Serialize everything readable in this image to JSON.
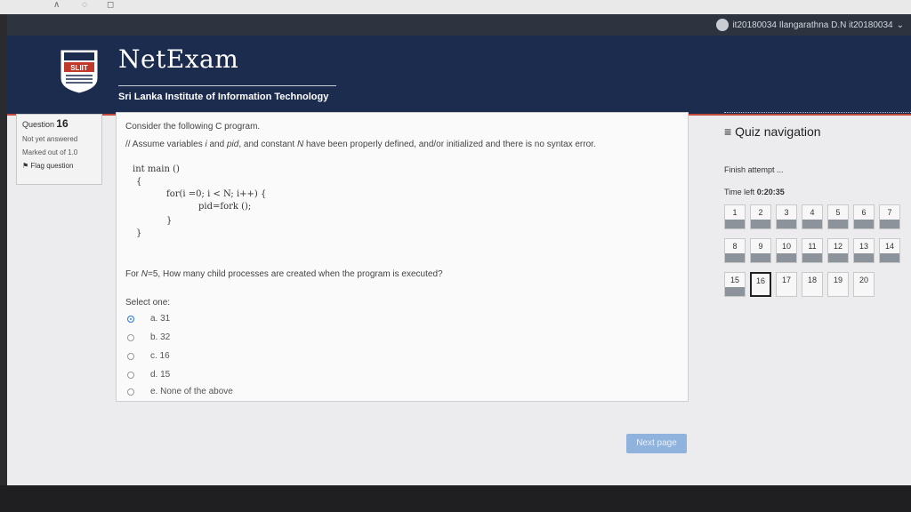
{
  "user": {
    "name": "it20180034 Ilangarathna D.N it20180034",
    "chevron": "⌄"
  },
  "brand": {
    "title": "NetExam",
    "tagline": "Sri Lanka Institute of Information Technology",
    "logo_text": "SLIIT"
  },
  "question_info": {
    "label": "Question",
    "number": "16",
    "status": "Not yet answered",
    "marks": "Marked out of 1.0",
    "flag": "Flag question"
  },
  "question": {
    "intro": "Consider the following C program.",
    "comment_parts": [
      "// Assume variables ",
      "i",
      " and ",
      "pid",
      ", and constant ",
      "N",
      " have been properly defined, and/or initialized and there is no syntax error."
    ],
    "code": {
      "l1": "int main ()",
      "l2": "{",
      "l3": "for(i =0; i < N; i++) {",
      "l4": "pid=fork ();",
      "l5": "}",
      "l6": "}"
    },
    "prompt_parts": [
      "For ",
      "N",
      "=5, How many child processes are created when the program is executed?"
    ],
    "select_label": "Select one:",
    "options": [
      "a. 31",
      "b. 32",
      "c. 16",
      "d. 15",
      "e. None of the above"
    ],
    "selected_index": 0
  },
  "next_button": "Next page",
  "nav": {
    "title": "Quiz navigation",
    "finish": "Finish attempt ...",
    "time_label": "Time left",
    "time_value": "0:20:35",
    "current": 16,
    "answered": [
      1,
      2,
      3,
      4,
      5,
      6,
      7,
      8,
      9,
      10,
      11,
      12,
      13,
      14,
      15
    ],
    "numbers": [
      "1",
      "2",
      "3",
      "4",
      "5",
      "6",
      "7",
      "8",
      "9",
      "10",
      "11",
      "12",
      "13",
      "14",
      "15",
      "16",
      "17",
      "18",
      "19",
      "20"
    ]
  }
}
